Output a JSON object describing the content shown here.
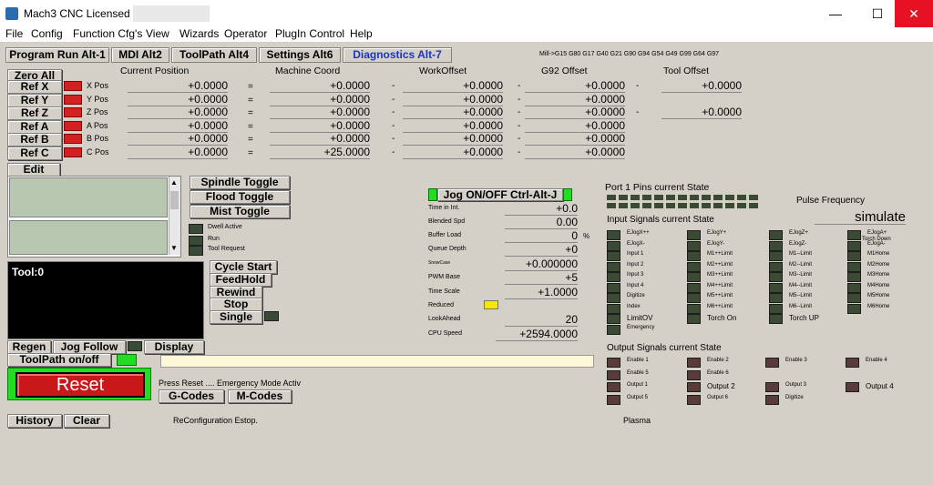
{
  "window": {
    "title": "Mach3 CNC  Licensed To:",
    "minimize": "—",
    "maximize": "☐",
    "close": "✕"
  },
  "menu": [
    "File",
    "Config",
    "Function Cfg's",
    "View",
    "Wizards",
    "Operator",
    "PlugIn Control",
    "Help"
  ],
  "tabs": [
    "Program Run Alt-1",
    "MDI Alt2",
    "ToolPath Alt4",
    "Settings Alt6",
    "Diagnostics Alt-7"
  ],
  "gcodes_line": "Mill->G15  G80 G17 G40 G21 G90 G94 G54 G49 G99 G64 G97",
  "zero_all": "Zero All",
  "headers": {
    "current": "Current Position",
    "machine": "Machine Coord",
    "work": "WorkOffset",
    "g92": "G92 Offset",
    "tool": "Tool Offset"
  },
  "axes": [
    {
      "ref": "Ref X",
      "pos": "X Pos",
      "cur": "+0.0000",
      "mach": "+0.0000",
      "work": "+0.0000",
      "g92": "+0.0000",
      "tool": "+0.0000"
    },
    {
      "ref": "Ref Y",
      "pos": "Y Pos",
      "cur": "+0.0000",
      "mach": "+0.0000",
      "work": "+0.0000",
      "g92": "+0.0000",
      "tool": ""
    },
    {
      "ref": "Ref Z",
      "pos": "Z Pos",
      "cur": "+0.0000",
      "mach": "+0.0000",
      "work": "+0.0000",
      "g92": "+0.0000",
      "tool": "+0.0000"
    },
    {
      "ref": "Ref A",
      "pos": "A Pos",
      "cur": "+0.0000",
      "mach": "+0.0000",
      "work": "+0.0000",
      "g92": "+0.0000",
      "tool": ""
    },
    {
      "ref": "Ref B",
      "pos": "B Pos",
      "cur": "+0.0000",
      "mach": "+0.0000",
      "work": "+0.0000",
      "g92": "+0.0000",
      "tool": ""
    },
    {
      "ref": "Ref C",
      "pos": "C Pos",
      "cur": "+0.0000",
      "mach": "+25.0000",
      "work": "+0.0000",
      "g92": "+0.0000",
      "tool": ""
    }
  ],
  "edit": "Edit",
  "spindle_buttons": [
    "Spindle Toggle",
    "Flood Toggle",
    "Mist Toggle"
  ],
  "status_leds": [
    "Dwell Active",
    "Run",
    "Tool Request"
  ],
  "tool_label": "Tool:0",
  "cycle_buttons": [
    "Cycle Start",
    "FeedHold",
    "Rewind",
    "Stop",
    "Single"
  ],
  "regen": "Regen",
  "jog_follow": "Jog Follow",
  "display": "Display",
  "toolpath_onoff": "ToolPath on/off",
  "reset": "Reset",
  "reset_msg": "Press Reset .... Emergency Mode Activ",
  "gcodes_btn": "G-Codes",
  "mcodes_btn": "M-Codes",
  "history": "History",
  "clear": "Clear",
  "status_msg": "ReConfiguration Estop.",
  "jog_btn": "Jog ON/OFF Ctrl-Alt-J",
  "diag": [
    {
      "label": "Time in Int.",
      "value": "+0.0"
    },
    {
      "label": "Blended Spd",
      "value": "0.00"
    },
    {
      "label": "Buffer Load",
      "value": "0",
      "unit": "%"
    },
    {
      "label": "Queue Depth",
      "value": "+0"
    },
    {
      "label": "SnowCase",
      "value": "+0.000000"
    },
    {
      "label": "PWM Base",
      "value": "+5"
    },
    {
      "label": "Time Scale",
      "value": "+1.0000"
    },
    {
      "label": "Reduced",
      "value": ""
    },
    {
      "label": "LookAhead",
      "value": "20"
    },
    {
      "label": "CPU Speed",
      "value": "+2594.0000"
    }
  ],
  "port_title": "Port 1 Pins current State",
  "pulse_freq": "Pulse Frequency",
  "pulse_val": "simulate",
  "input_title": "Input Signals current State",
  "inputs": [
    [
      "EJogX++",
      "EJogY+",
      "EJogZ+",
      "EJogA+"
    ],
    [
      "EJogX-",
      "EJogY-",
      "EJogZ-",
      "EJogA-"
    ],
    [
      "Input 1",
      "M1++Limit",
      "M1--Limit",
      "M1Home"
    ],
    [
      "Input 2",
      "M2++Limit",
      "M2--Limit",
      "M2Home"
    ],
    [
      "Input 3",
      "M3++Limit",
      "M3--Limit",
      "M3Home"
    ],
    [
      "Input 4",
      "M4++Limit",
      "M4--Limit",
      "M4Home"
    ],
    [
      "Digitize",
      "M5++Limit",
      "M5--Limit",
      "M5Home"
    ],
    [
      "Index",
      "M6++Limit",
      "M6--Limit",
      "M6Home"
    ],
    [
      "LimitOV",
      "Torch On",
      "Torch UP",
      ""
    ],
    [
      "Emergency",
      "",
      "",
      ""
    ]
  ],
  "torch_down": "Torch Down",
  "output_title": "Output Signals current State",
  "outputs": [
    [
      "Enable 1",
      "Enable 2",
      "Enable 3",
      "Enable 4"
    ],
    [
      "Enable 5",
      "Enable 6",
      "",
      ""
    ],
    [
      "Output 1",
      "Output 2",
      "Output 3",
      "Output 4"
    ],
    [
      "Output 5",
      "Output 6",
      "Digitize",
      ""
    ]
  ],
  "plasma": "Plasma"
}
